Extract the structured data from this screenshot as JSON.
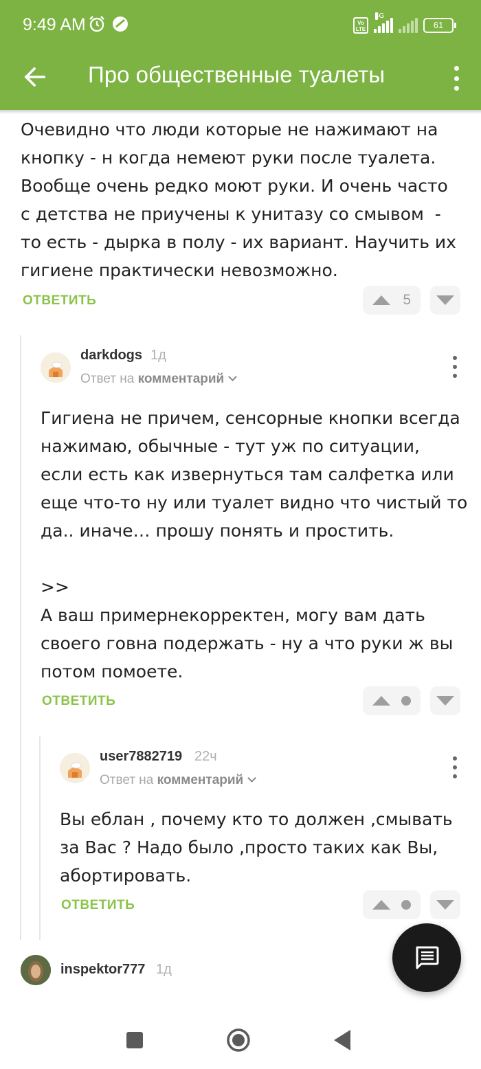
{
  "status_bar": {
    "time": "9:49 AM",
    "network": "4G",
    "volte_label": "Vo LTE",
    "battery": "61",
    "icons": [
      "alarm-icon",
      "vpn-icon",
      "volte-icon",
      "signal-icon",
      "battery-icon"
    ]
  },
  "app_bar": {
    "title": "Про общественные туалеты",
    "back_icon": "arrow-back-icon",
    "menu_icon": "more-vert-icon"
  },
  "comments": [
    {
      "text": "Очевидно что люди которые не нажимают на\nкнопку - н когда немеют руки после туалета.\nВообще очень редко моют руки. И очень часто\nс детства не приучены к унитазу со смывом  -\nто есть - дырка в полу - их вариант. Научить их\nгигиене практически невозможно.",
      "reply_label": "ОТВЕТИТЬ",
      "score": "5"
    },
    {
      "username": "darkdogs",
      "ago": "1д",
      "reply_to_prefix": "Ответ на",
      "reply_to_target": "комментарий",
      "text": "Гигиена не причем, сенсорные кнопки всегда\nнажимаю, обычные - тут уж по ситуации,\nесли есть как извернуться там салфетка или\nеще что-то ну или туалет видно что чистый то\nда.. иначе… прошу понять и простить.\n\n>>\nА ваш примернекорректен, могу вам дать\nсвоего говна подержать - ну а что руки ж вы\nпотом помоете.",
      "reply_label": "ОТВЕТИТЬ"
    },
    {
      "username": "user7882719",
      "ago": "22ч",
      "reply_to_prefix": "Ответ на",
      "reply_to_target": "комментарий",
      "text": "Вы еблан , почему кто то должен ,смывать\nза Вас ? Надо было ,просто таких как Вы,\nабортировать.",
      "reply_label": "ОТВЕТИТЬ"
    },
    {
      "username": "inspektor777",
      "ago": "1д"
    }
  ],
  "fab": {
    "icon": "comment-icon"
  },
  "nav_bar": {
    "icons": [
      "recents-square-icon",
      "home-circle-icon",
      "back-triangle-icon"
    ]
  },
  "colors": {
    "accent": "#7cb342",
    "reply": "#8bc34a",
    "fab": "#1a1a1a"
  }
}
